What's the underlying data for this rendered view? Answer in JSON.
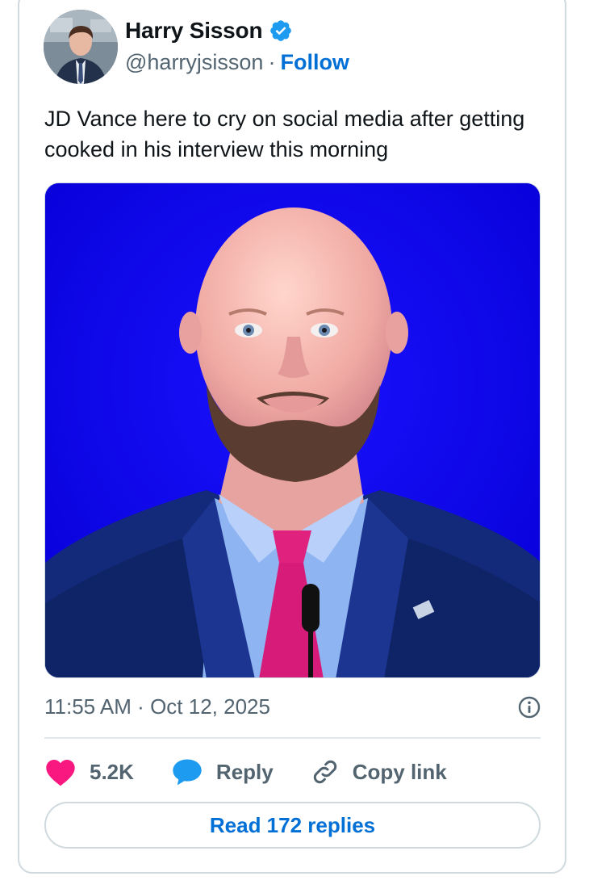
{
  "author": {
    "name": "Harry Sisson",
    "handle": "@harryjsisson",
    "separator": "·",
    "follow_label": "Follow"
  },
  "tweet": {
    "text": "JD Vance here to cry on social media after getting cooked in his interview this morning",
    "time": "11:55 AM",
    "date_separator": "·",
    "date": "Oct 12, 2025"
  },
  "actions": {
    "likes": "5.2K",
    "reply_label": "Reply",
    "copy_label": "Copy link"
  },
  "read_replies_label": "Read 172 replies",
  "colors": {
    "accent": "#006fd6",
    "verified": "#1d9bf0",
    "like": "#f91880",
    "reply_bubble": "#1d9bf0",
    "muted": "#536471",
    "border": "#cfd9de",
    "photo_background": "#0a00f0"
  },
  "icons": {
    "verified": "verified-badge-icon",
    "info": "info-icon",
    "like": "heart-icon",
    "reply": "speech-bubble-icon",
    "copy": "link-icon"
  }
}
